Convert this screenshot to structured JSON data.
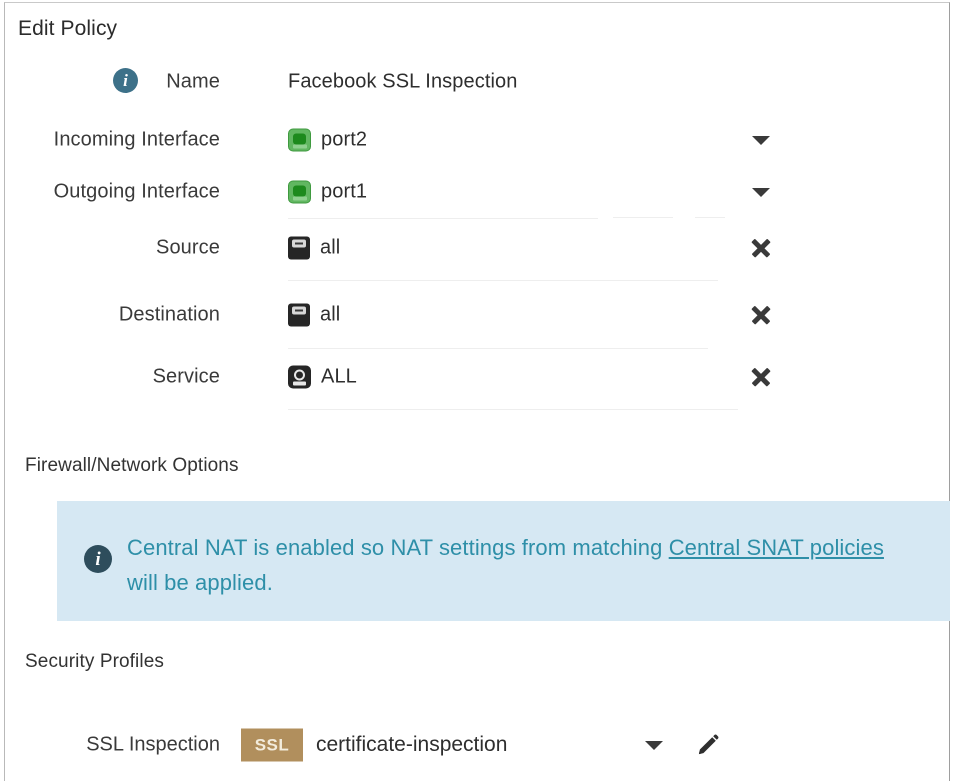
{
  "dialog": {
    "title": "Edit Policy"
  },
  "fields": [
    {
      "label": "Name",
      "value": "Facebook SSL Inspection",
      "icon": "",
      "info_icon": "info-icon",
      "info_glyph": "i",
      "action": "none"
    },
    {
      "label": "Incoming Interface",
      "value": "port2",
      "icon": "port-icon",
      "action": "dropdown-caret"
    },
    {
      "label": "Outgoing Interface",
      "value": "port1",
      "icon": "port-icon",
      "action": "dropdown-caret"
    },
    {
      "label": "Source",
      "value": "all",
      "icon": "address-object-icon",
      "action": "remove-x"
    },
    {
      "label": "Destination",
      "value": "all",
      "icon": "address-object-icon",
      "action": "remove-x"
    },
    {
      "label": "Service",
      "value": "ALL",
      "icon": "service-object-icon",
      "action": "remove-x"
    }
  ],
  "sections": {
    "firewall_network_options": "Firewall/Network Options",
    "security_profiles": "Security Profiles"
  },
  "banner": {
    "icon_glyph": "i",
    "text_before_link": "Central NAT is enabled so NAT settings from matching ",
    "link_text": "Central SNAT policies",
    "text_after_link": " will be applied.",
    "background_color": "#d6e8f3",
    "text_color": "#2e8fa8"
  },
  "ssl_inspection": {
    "label": "SSL Inspection",
    "badge_text": "SSL",
    "badge_color": "#b18f5d",
    "value": "certificate-inspection",
    "caret": "dropdown-caret",
    "edit": "edit-pencil-icon"
  }
}
